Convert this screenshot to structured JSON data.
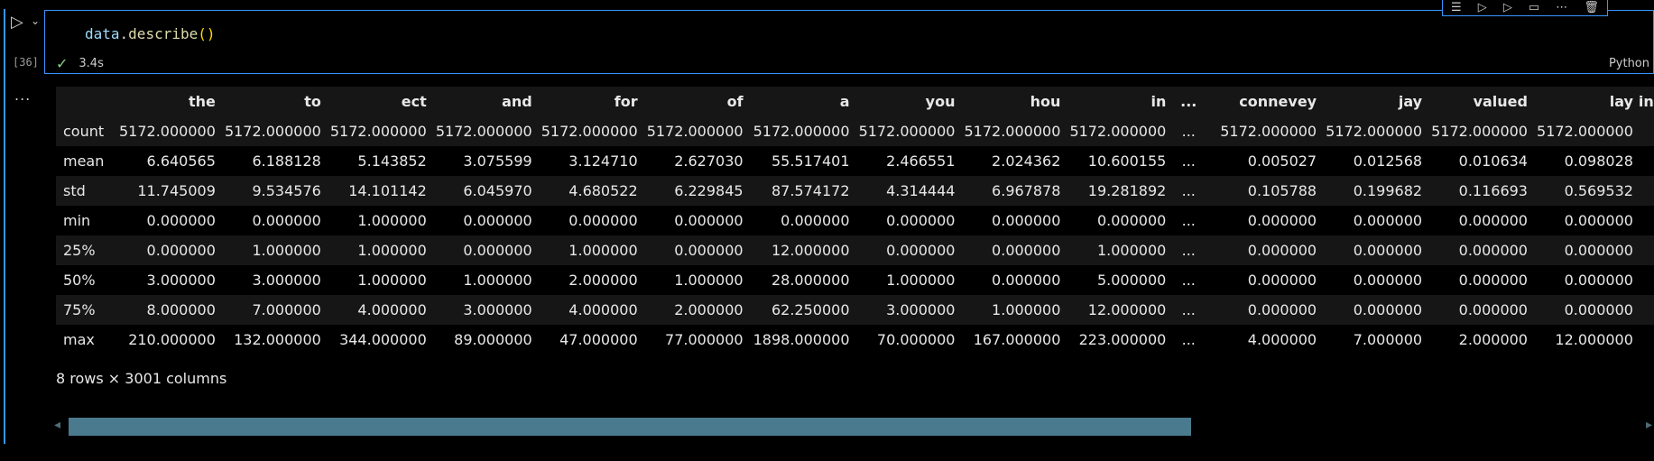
{
  "cell": {
    "exec_count": "[36]",
    "code": {
      "var": "data",
      "dot": ".",
      "fn": "describe",
      "paren": "()"
    },
    "elapsed": "3.4s",
    "language": "Python",
    "output_more": "..."
  },
  "table": {
    "columns": [
      "the",
      "to",
      "ect",
      "and",
      "for",
      "of",
      "a",
      "you",
      "hou",
      "in",
      "...",
      "connevey",
      "jay",
      "valued",
      "lay",
      "in"
    ],
    "rows": [
      {
        "label": "count",
        "values": [
          "5172.000000",
          "5172.000000",
          "5172.000000",
          "5172.000000",
          "5172.000000",
          "5172.000000",
          "5172.000000",
          "5172.000000",
          "5172.000000",
          "5172.000000",
          "...",
          "5172.000000",
          "5172.000000",
          "5172.000000",
          "5172.000000",
          ""
        ]
      },
      {
        "label": "mean",
        "values": [
          "6.640565",
          "6.188128",
          "5.143852",
          "3.075599",
          "3.124710",
          "2.627030",
          "55.517401",
          "2.466551",
          "2.024362",
          "10.600155",
          "...",
          "0.005027",
          "0.012568",
          "0.010634",
          "0.098028",
          ""
        ]
      },
      {
        "label": "std",
        "values": [
          "11.745009",
          "9.534576",
          "14.101142",
          "6.045970",
          "4.680522",
          "6.229845",
          "87.574172",
          "4.314444",
          "6.967878",
          "19.281892",
          "...",
          "0.105788",
          "0.199682",
          "0.116693",
          "0.569532",
          ""
        ]
      },
      {
        "label": "min",
        "values": [
          "0.000000",
          "0.000000",
          "1.000000",
          "0.000000",
          "0.000000",
          "0.000000",
          "0.000000",
          "0.000000",
          "0.000000",
          "0.000000",
          "...",
          "0.000000",
          "0.000000",
          "0.000000",
          "0.000000",
          ""
        ]
      },
      {
        "label": "25%",
        "values": [
          "0.000000",
          "1.000000",
          "1.000000",
          "0.000000",
          "1.000000",
          "0.000000",
          "12.000000",
          "0.000000",
          "0.000000",
          "1.000000",
          "...",
          "0.000000",
          "0.000000",
          "0.000000",
          "0.000000",
          ""
        ]
      },
      {
        "label": "50%",
        "values": [
          "3.000000",
          "3.000000",
          "1.000000",
          "1.000000",
          "2.000000",
          "1.000000",
          "28.000000",
          "1.000000",
          "0.000000",
          "5.000000",
          "...",
          "0.000000",
          "0.000000",
          "0.000000",
          "0.000000",
          ""
        ]
      },
      {
        "label": "75%",
        "values": [
          "8.000000",
          "7.000000",
          "4.000000",
          "3.000000",
          "4.000000",
          "2.000000",
          "62.250000",
          "3.000000",
          "1.000000",
          "12.000000",
          "...",
          "0.000000",
          "0.000000",
          "0.000000",
          "0.000000",
          ""
        ]
      },
      {
        "label": "max",
        "values": [
          "210.000000",
          "132.000000",
          "344.000000",
          "89.000000",
          "47.000000",
          "77.000000",
          "1898.000000",
          "70.000000",
          "167.000000",
          "223.000000",
          "...",
          "4.000000",
          "7.000000",
          "2.000000",
          "12.000000",
          ""
        ]
      }
    ],
    "shape_text": "8 rows × 3001 columns"
  },
  "toolbar": {
    "icons": [
      "run-by-line-icon",
      "execute-above-icon",
      "execute-below-icon",
      "split-cell-icon",
      "more-actions-icon",
      "delete-cell-icon"
    ]
  },
  "colors": {
    "accent": "#3794ff",
    "scroll_thumb": "#4a7a8e",
    "success": "#89d185"
  }
}
